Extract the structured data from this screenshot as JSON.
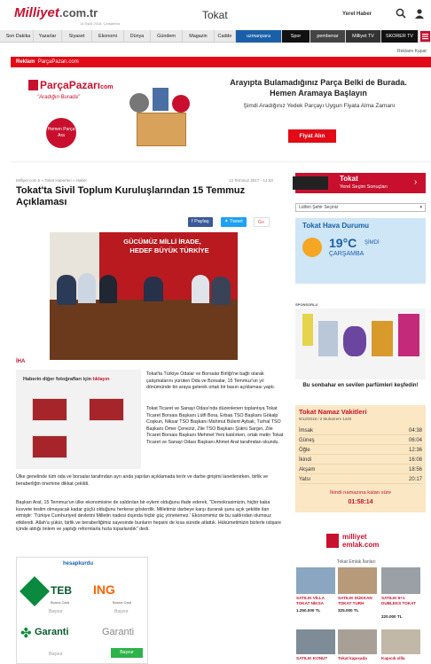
{
  "header": {
    "logo": "Milliyet",
    "logo_domain": ".com.tr",
    "logo_sub": "14 Eylül 2018, Çarşamba",
    "city": "Tokat",
    "yerel_haber": "Yerel Haber"
  },
  "nav": {
    "items": [
      "Son Dakika",
      "Yazarlar",
      "Siyaset",
      "Ekonomi",
      "Dünya",
      "Gündem",
      "Magazin",
      "Cadde",
      "uzmanpara",
      "Spor",
      "pembenar",
      "Milliyet TV",
      "SKORER TV"
    ]
  },
  "ad": {
    "reklam_label": "Reklam",
    "reklam_site": "ParçaPazarı.com",
    "reklam_kapat": "Reklamı Kapat",
    "brand": "ParçaPazarı",
    "brand_suffix": "com",
    "slogan": "\"Aradığın Burada\"",
    "circle": "Hemen Parça Ara",
    "headline": "Arayıpta Bulamadığınız Parça Belki de Burada. Hemen Aramaya Başlayın",
    "sub": "Şimdi Aradığınız Yedek Parçayı Uygun Fiyata Alma Zamanı",
    "cta": "Fiyat Alın"
  },
  "article": {
    "breadcrumb": "Milliyet.com.tr » Tokat Haberleri » Haber",
    "date": "13 Temmuz 2017 - 14:53",
    "title": "Tokat'ta Sivil Toplum Kuruluşlarından 15 Temmuz Açıklaması",
    "share_fb": "Paylaş",
    "share_tw": "Tweet",
    "share_gp": "G+",
    "banner_line1": "GÜCÜMÜZ MİLLİ İRADE,",
    "banner_line2": "HEDEF BÜYÜK TÜRKİYE",
    "source": "İHA",
    "gallery_title": "Haberin diğer fotoğrafları için",
    "gallery_link": "tıklayın",
    "para1": "Tokat'ta Türkiye Odalar ve Borsalar Birliği'ne bağlı olarak çalışmalarını yürüten Oda ve Borsalar, 15 Temmuz'un yıl dönümünde bir araya gelerek ortak bir basın açıklaması yaptı.",
    "para2": "Tokat Ticaret ve Sanayi Odası'nda düzenlenen toplantıya Tokat Ticaret Borsası Başkanı Lütfi Bora, Erbaa TSO Başkanı Gökalp Coşkun, Niksar TSO Başkanı Mahmut Bülent Aybak, Turhal TSO Başkanı Ömer Çeneziz, Zile TSO Başkanı Şükrü Sargın, Zile Ticaret Borsası Başkanı Mehmet Yeni katılırken, ortak metin Tokat Ticaret ve Sanayi Odası Başkanı Ahmet Arat tarafından okundu.",
    "para3": "Ülke genelinde tüm oda ve borsalar tarafından ayrı anda yapılan açıklamada terör ve darbe girişimi lanetlenirken, birlik ve beraberliğin önemine dikkat çekildi.",
    "para4": "Başkan Arat, 15 Temmuz'un ülke ekonomisine de saldırılan bir eylem olduğunu ifade ederek, \"Demokrasimizin, hiçbir kaba kuvvete teslim olmayacak kadar güçlü olduğunu herkese gösterdik. Milletimiz darbeye karşı durarak şunu açık şekilde ilan etmiştir: 'Türkiye Cumhuriyeti devletini Milletin iradesi dışında hiçbir güç yönetemez.' Ekonomimiz de bu saldırıdan olumsuz etkilendi. Allah'a şükür, birlik ve beraberliğimiz sayesinde bunların hepsini de kısa sürede atlattık. Hükümetimizin bizlerle istişare içinde aldığı önlem ve yaptığı reformlarla hızla toparlandık\" dedi."
  },
  "sidebar": {
    "tokat_title": "Tokat",
    "tokat_sub": "Yerel Seçim Sonuçları",
    "select_placeholder": "Lütfen Şehir Seçiniz",
    "weather_title": "Tokat Hava Durumu",
    "temp": "19°C",
    "temp_now": "ŞİMDİ",
    "day": "ÇARŞAMBA",
    "sponsored": "SPONSORLU",
    "perfume_text": "Bu sonbahar en sevilen parfümleri keşfedin!",
    "namaz_title": "Tokat Namaz Vakitleri",
    "namaz_date": "9/12/2018 / 2 Muharrem 1440",
    "times": [
      {
        "name": "İmsak",
        "time": "04:38"
      },
      {
        "name": "Güneş",
        "time": "06:04"
      },
      {
        "name": "Öğle",
        "time": "12:36"
      },
      {
        "name": "İkindi",
        "time": "16:08"
      },
      {
        "name": "Akşam",
        "time": "18:56"
      },
      {
        "name": "Yatsı",
        "time": "20:17"
      }
    ],
    "kalan_label": "İkindi namazına kalan süre",
    "kalan": "01:58:14",
    "emlak_logo1": "milliyet",
    "emlak_logo2": "emlak.com",
    "emlak_caption": "Tokat Emlak İlanları",
    "listings": [
      {
        "title": "SATILIK VİLLA TOKAT NİKSA",
        "price": "1.250.000 TL"
      },
      {
        "title": "SATILIK DÜKKAN TOKAT TURH",
        "price": "325.000 TL"
      },
      {
        "title": "SATILIK 6+1 DUBLEKS TOKAT",
        "price": "220.000 TL"
      }
    ],
    "listings2": [
      "SATILIK KONUT",
      "Tokat kapısada",
      "Kapıcık villa"
    ]
  },
  "bank_ad": {
    "logo": "hesapkurdu",
    "teb": "TEB",
    "ing": "ING",
    "bonus": "Bonus Card",
    "basvur": "Başvur",
    "garanti": "Garanti"
  },
  "colors": {
    "brand_red": "#c8102e",
    "nav_bg": "#eaeaea",
    "weather_bg": "#cfe6f7",
    "namaz_bg": "#fbe7c4"
  }
}
